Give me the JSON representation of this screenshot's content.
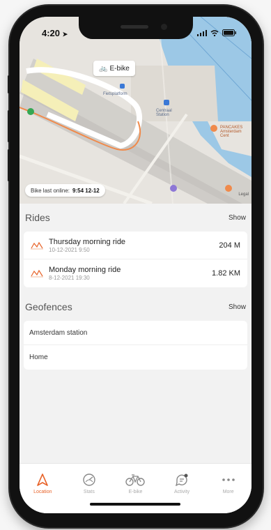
{
  "status": {
    "time": "4:20"
  },
  "map": {
    "ebike_label": "E-bike",
    "place_labels": {
      "fietsplatform": "Fietsplatform",
      "centraal_station": "Centraal Station",
      "pancakes": "PANCAKES Amsterdam Cent"
    },
    "bike_online_label": "Bike last online:",
    "bike_online_time": "9:54 12-12",
    "legal": "Legal"
  },
  "rides": {
    "title": "Rides",
    "action": "Show",
    "items": [
      {
        "name": "Thursday morning ride",
        "date": "10-12-2021 9:50",
        "distance": "204 M"
      },
      {
        "name": "Monday morning ride",
        "date": "8-12-2021 19:30",
        "distance": "1.82 KM"
      }
    ]
  },
  "geofences": {
    "title": "Geofences",
    "action": "Show",
    "items": [
      {
        "name": "Amsterdam station"
      },
      {
        "name": "Home"
      }
    ]
  },
  "tabbar": {
    "items": [
      {
        "label": "Location",
        "icon": "location-arrow-icon",
        "active": true
      },
      {
        "label": "Stats",
        "icon": "stats-icon",
        "active": false
      },
      {
        "label": "E-bike",
        "icon": "bike-icon",
        "active": false
      },
      {
        "label": "Activity",
        "icon": "activity-icon",
        "active": false
      },
      {
        "label": "More",
        "icon": "more-icon",
        "active": false
      }
    ]
  },
  "colors": {
    "accent": "#e8642a",
    "water": "#9cc8e6"
  }
}
